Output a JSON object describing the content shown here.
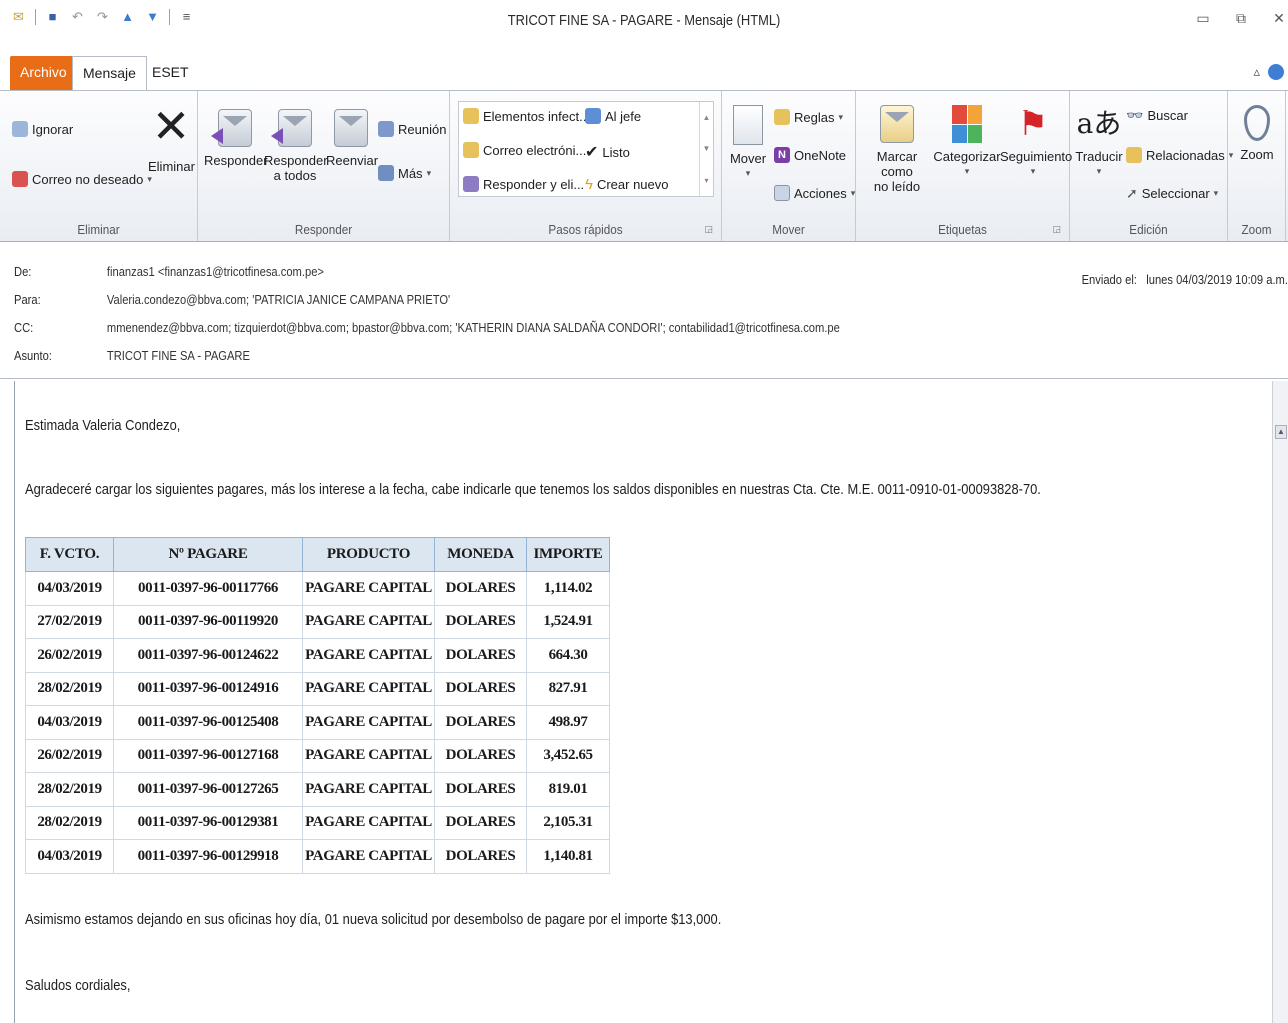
{
  "window": {
    "title": "TRICOT FINE SA - PAGARE - Mensaje (HTML)"
  },
  "tabs": {
    "archivo": "Archivo",
    "mensaje": "Mensaje",
    "eset": "ESET"
  },
  "ribbon": {
    "eliminar": {
      "label": "Eliminar",
      "ignorar": "Ignorar",
      "correo_no_deseado": "Correo no deseado",
      "eliminar_btn": "Eliminar"
    },
    "responder": {
      "label": "Responder",
      "responder_btn": "Responder",
      "responder_todos_1": "Responder",
      "responder_todos_2": "a todos",
      "reenviar": "Reenviar",
      "reunion": "Reunión",
      "mas": "Más"
    },
    "pasos_rapidos": {
      "label": "Pasos rápidos",
      "items": [
        "Elementos infect...",
        "Al jefe",
        "Correo electróni...",
        "Listo",
        "Responder y eli...",
        "Crear nuevo"
      ]
    },
    "mover": {
      "label": "Mover",
      "mover_btn": "Mover",
      "reglas": "Reglas",
      "onenote": "OneNote",
      "acciones": "Acciones"
    },
    "etiquetas": {
      "label": "Etiquetas",
      "marcar_1": "Marcar como",
      "marcar_2": "no leído",
      "categorizar": "Categorizar",
      "seguimiento": "Seguimiento"
    },
    "edicion": {
      "label": "Edición",
      "traducir": "Traducir",
      "buscar": "Buscar",
      "relacionadas": "Relacionadas",
      "seleccionar": "Seleccionar"
    },
    "zoom": {
      "label": "Zoom",
      "zoom_btn": "Zoom"
    }
  },
  "header": {
    "de_label": "De:",
    "de_value": "finanzas1 <finanzas1@tricotfinesa.com.pe>",
    "para_label": "Para:",
    "para_value": "Valeria.condezo@bbva.com; 'PATRICIA JANICE CAMPANA PRIETO'",
    "cc_label": "CC:",
    "cc_value": "mmenendez@bbva.com; tizquierdot@bbva.com; bpastor@bbva.com; 'KATHERIN DIANA SALDAÑA CONDORI'; contabilidad1@tricotfinesa.com.pe",
    "asunto_label": "Asunto:",
    "asunto_value": "TRICOT FINE SA - PAGARE",
    "enviado_label": "Enviado el:",
    "enviado_value": "lunes 04/03/2019 10:09 a.m."
  },
  "body": {
    "greeting": "Estimada Valeria Condezo,",
    "paragraph1": "Agradeceré cargar los siguientes pagares, más los interese a la fecha, cabe indicarle que tenemos los saldos disponibles en nuestras Cta. Cte. M.E. 0011-0910-01-00093828-70.",
    "paragraph2": "Asimismo estamos dejando en sus oficinas hoy día, 01 nueva solicitud por desembolso de pagare por el importe  $13,000.",
    "closing": "Saludos cordiales,",
    "table": {
      "headers": [
        "F. VCTO.",
        "Nº PAGARE",
        "PRODUCTO",
        "MONEDA",
        "IMPORTE"
      ],
      "rows": [
        [
          "04/03/2019",
          "0011-0397-96-00117766",
          "PAGARE CAPITAL",
          "DOLARES",
          "1,114.02"
        ],
        [
          "27/02/2019",
          "0011-0397-96-00119920",
          "PAGARE CAPITAL",
          "DOLARES",
          "1,524.91"
        ],
        [
          "26/02/2019",
          "0011-0397-96-00124622",
          "PAGARE CAPITAL",
          "DOLARES",
          "664.30"
        ],
        [
          "28/02/2019",
          "0011-0397-96-00124916",
          "PAGARE CAPITAL",
          "DOLARES",
          "827.91"
        ],
        [
          "04/03/2019",
          "0011-0397-96-00125408",
          "PAGARE CAPITAL",
          "DOLARES",
          "498.97"
        ],
        [
          "26/02/2019",
          "0011-0397-96-00127168",
          "PAGARE CAPITAL",
          "DOLARES",
          "3,452.65"
        ],
        [
          "28/02/2019",
          "0011-0397-96-00127265",
          "PAGARE CAPITAL",
          "DOLARES",
          "819.01"
        ],
        [
          "28/02/2019",
          "0011-0397-96-00129381",
          "PAGARE CAPITAL",
          "DOLARES",
          "2,105.31"
        ],
        [
          "04/03/2019",
          "0011-0397-96-00129918",
          "PAGARE CAPITAL",
          "DOLARES",
          "1,140.81"
        ]
      ]
    }
  },
  "colors": {
    "archivo_tab": "#e96c17",
    "table_header_bg": "#dce6f1"
  }
}
